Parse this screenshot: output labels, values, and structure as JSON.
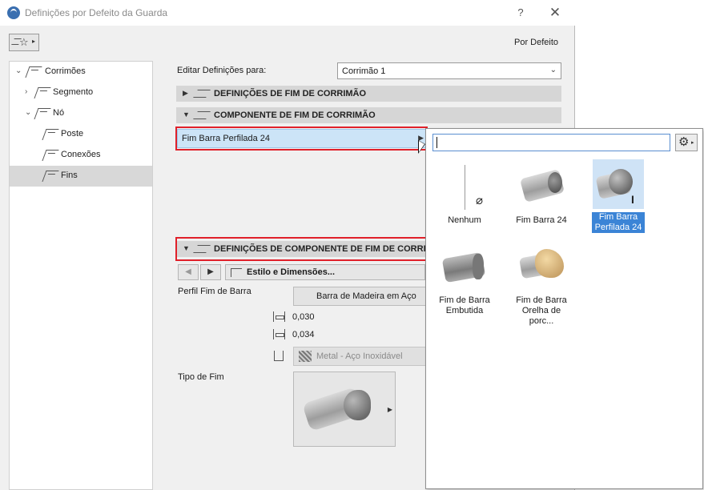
{
  "window": {
    "title": "Definições por Defeito da Guarda",
    "help": "?",
    "close": "✕"
  },
  "toolbar": {
    "preset_label": "Por Defeito"
  },
  "tree": {
    "items": [
      {
        "label": "Corrimões",
        "expander": "⌄"
      },
      {
        "label": "Segmento",
        "expander": "›"
      },
      {
        "label": "Nó",
        "expander": "⌄"
      },
      {
        "label": "Poste"
      },
      {
        "label": "Conexões"
      },
      {
        "label": "Fins"
      }
    ],
    "selected": "Fins"
  },
  "edit": {
    "label": "Editar Definições para:",
    "value": "Corrimão 1"
  },
  "panels": {
    "end_settings": "DEFINIÇÕES DE FIM DE CORRIMÃO",
    "end_component": "COMPONENTE DE FIM DE CORRIMÃO",
    "component_settings": "DEFINIÇÕES DE COMPONENTE DE FIM DE CORRIMA"
  },
  "component": {
    "selected": "Fim Barra Perfilada 24"
  },
  "style": {
    "label": "Estilo e Dimensões..."
  },
  "profile": {
    "label": "Perfil Fim de Barra",
    "value": "Barra de Madeira em Aço",
    "dim1": "0,030",
    "dim2": "0,034",
    "material": "Metal - Aço Inoxidável"
  },
  "end_type": {
    "label": "Tipo de Fim"
  },
  "popup": {
    "search_value": "",
    "items": [
      {
        "caption": "Nenhum"
      },
      {
        "caption": "Fim Barra 24"
      },
      {
        "caption": "Fim Barra\nPerfilada 24",
        "selected": true
      },
      {
        "caption": "Fim de Barra\nEmbutida"
      },
      {
        "caption": "Fim de Barra\nOrelha de porc..."
      }
    ]
  },
  "colors": {
    "highlight_red": "#e0202a",
    "selection_blue": "#3b84d6",
    "row_blue": "#cce4f7"
  }
}
